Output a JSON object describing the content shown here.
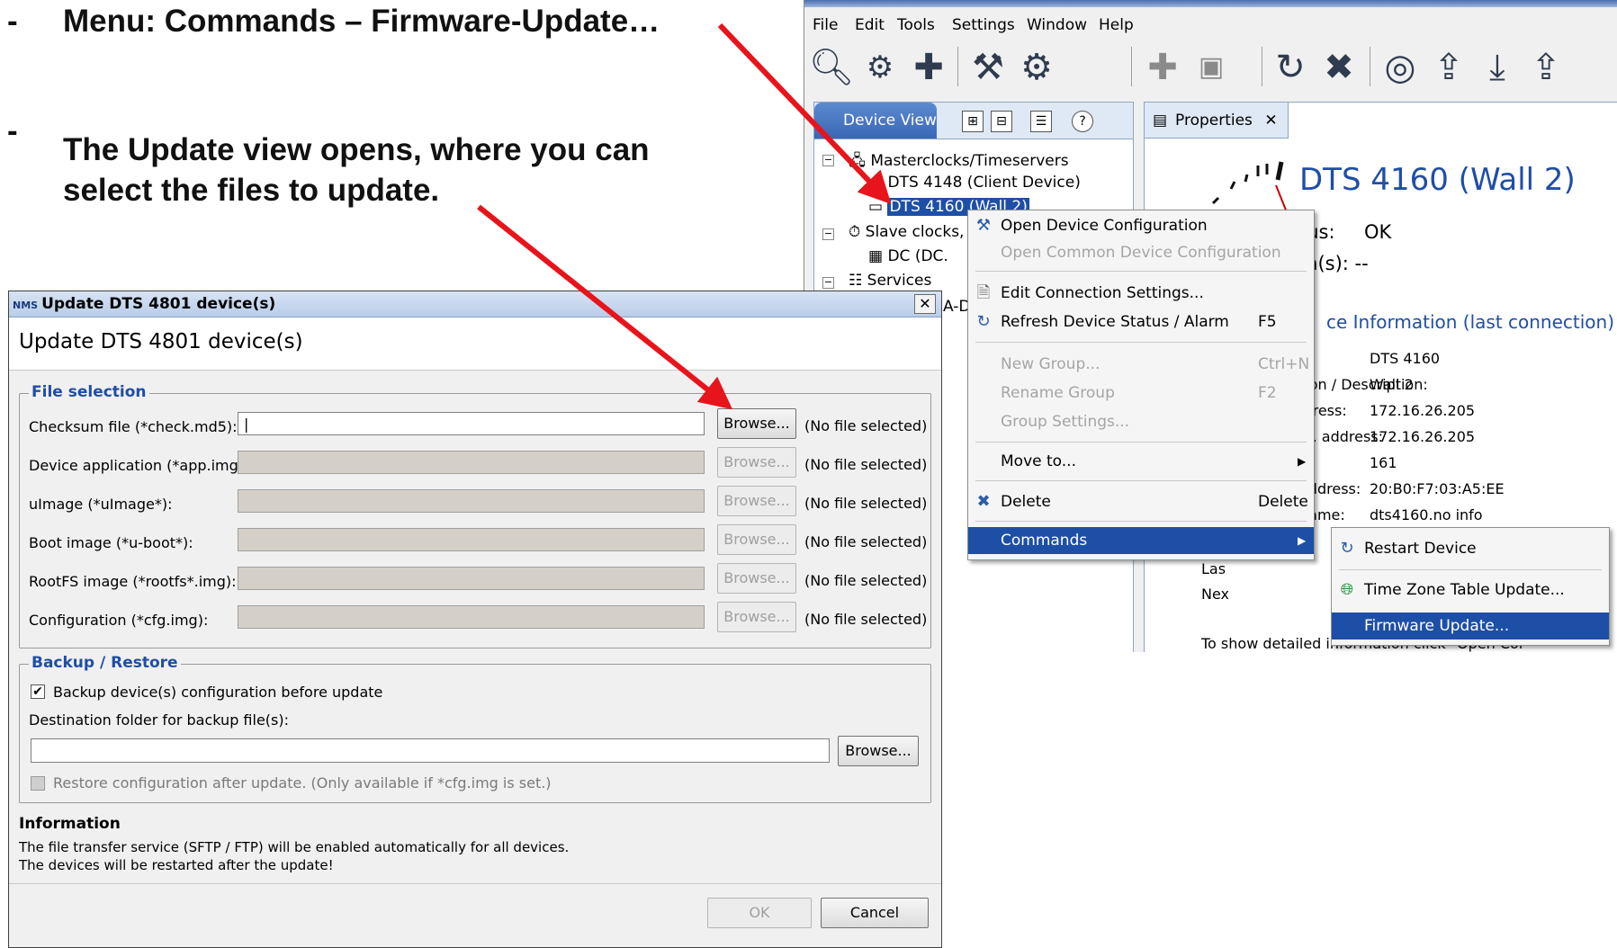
{
  "instructions": {
    "bullet": "-",
    "line1": "Menu:  Commands – Firmware-Update…",
    "line2a": "The Update view opens, where you can",
    "line2b": "select the files to update."
  },
  "app": {
    "menu": [
      "File",
      "Edit",
      "Tools",
      "Settings",
      "Window",
      "Help"
    ],
    "tree_tab": "Device View",
    "tree": {
      "masterclocks": "Masterclocks/Timeservers",
      "dts4148": "DTS 4148 (Client Device)",
      "dts4160": "DTS 4160 (Wall 2)",
      "slave": "Slave clocks,",
      "dc": "DC (DC.",
      "services": "Services",
      "ad": "A-D"
    },
    "props": {
      "tab": "Properties",
      "title": "DTS 4160 (Wall 2)",
      "status_label": "tus:",
      "status_value": "OK",
      "alarm_label": "m(s): --",
      "info_link": "ce Information (last connection)",
      "kv": [
        {
          "k": ":",
          "v": "DTS 4160"
        },
        {
          "k": "tion / Description:",
          "v": "Wall 2"
        },
        {
          "k": "ldress:",
          "v": "172.16.26.205"
        },
        {
          "k": "ig. address:",
          "v": "172.16.26.205"
        },
        {
          "k": "",
          "v": "161"
        },
        {
          "k": "address:",
          "v": "20:B0:F7:03:A5:EE"
        },
        {
          "k": "name:",
          "v": "dts4160.no info"
        }
      ],
      "last": "Las",
      "next": "Nex",
      "footer": "To show detailed information click \"Open Cor"
    },
    "context_menu": {
      "open_config": "Open Device Configuration",
      "open_common": "Open Common Device Configuration",
      "edit_conn": "Edit Connection Settings...",
      "refresh": "Refresh Device Status / Alarm",
      "refresh_sc": "F5",
      "new_group": "New Group...",
      "new_group_sc": "Ctrl+N",
      "rename_group": "Rename Group",
      "rename_sc": "F2",
      "group_settings": "Group Settings...",
      "move_to": "Move to...",
      "delete": "Delete",
      "delete_sc": "Delete",
      "commands": "Commands"
    },
    "submenu": {
      "restart": "Restart Device",
      "tz": "Time Zone Table Update...",
      "firmware": "Firmware Update..."
    }
  },
  "dialog": {
    "window_title": "Update DTS 4801 device(s)",
    "app_icon": "NMS",
    "header": "Update DTS 4801 device(s)",
    "file_selection_title": "File selection",
    "files": [
      {
        "label": "Checksum file (*check.md5):",
        "value": "",
        "enabled": true
      },
      {
        "label": "Device application (*app.img):",
        "value": "",
        "enabled": false
      },
      {
        "label": "uImage (*uImage*):",
        "value": "",
        "enabled": false
      },
      {
        "label": "Boot image (*u-boot*):",
        "value": "",
        "enabled": false
      },
      {
        "label": "RootFS image (*rootfs*.img):",
        "value": "",
        "enabled": false
      },
      {
        "label": "Configuration (*cfg.img):",
        "value": "",
        "enabled": false
      }
    ],
    "browse_label": "Browse...",
    "no_file": "(No file selected)",
    "backup_title": "Backup / Restore",
    "backup_check": "Backup device(s) configuration before update",
    "backup_checked": true,
    "dest_label": "Destination folder for backup file(s):",
    "dest_value": "",
    "restore_check": "Restore configuration after update. (Only available if *cfg.img is set.)",
    "info_title": "Information",
    "info_line1": "The file transfer service (SFTP / FTP) will be enabled automatically for all devices.",
    "info_line2": "The devices will be restarted after the update!",
    "ok": "OK",
    "cancel": "Cancel"
  },
  "colors": {
    "arrow": "#e8141b",
    "accent": "#1f4ea5",
    "selection": "#1e4fa6"
  }
}
